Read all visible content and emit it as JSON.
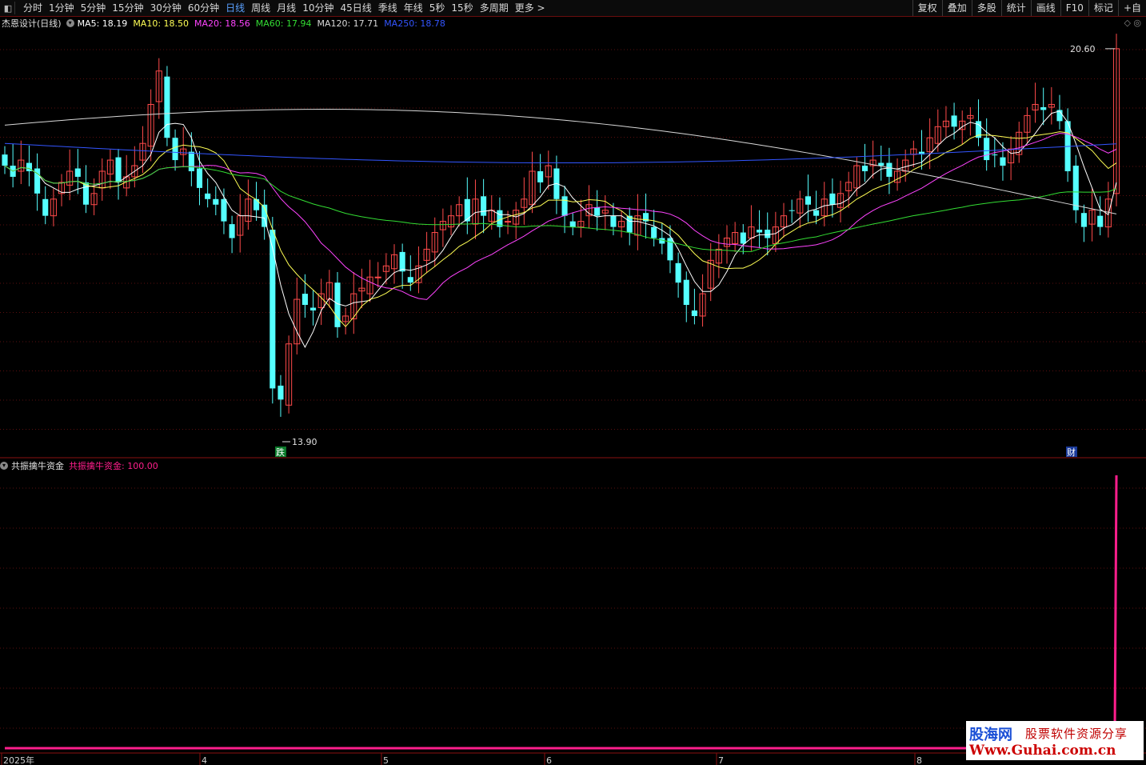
{
  "toolbar": {
    "menu_icon": "square-menu-icon",
    "periods": [
      "分时",
      "1分钟",
      "5分钟",
      "15分钟",
      "30分钟",
      "60分钟",
      "日线",
      "周线",
      "月线",
      "10分钟",
      "45日线",
      "季线",
      "年线",
      "5秒",
      "15秒",
      "多周期",
      "更多 >"
    ],
    "active_period": "日线",
    "tools": [
      "复权",
      "叠加",
      "多股",
      "统计",
      "画线",
      "F10",
      "标记",
      "+自"
    ]
  },
  "main_chart": {
    "title": "杰恩设计(日线)",
    "ma_legend": [
      {
        "label": "MA5: 18.19",
        "color": "#ffffff"
      },
      {
        "label": "MA10: 18.50",
        "color": "#ffff55"
      },
      {
        "label": "MA20: 18.56",
        "color": "#ff44ff"
      },
      {
        "label": "MA60: 17.94",
        "color": "#33dd33"
      },
      {
        "label": "MA120: 17.71",
        "color": "#d8d8d8"
      },
      {
        "label": "MA250: 18.78",
        "color": "#3355ff"
      }
    ],
    "high_label": "20.60",
    "low_label": "13.90",
    "marker_low": "跌",
    "marker_recent": "财",
    "corner_icons": "◇ ◎"
  },
  "indicator": {
    "title": "共振擒牛资金",
    "value_label": "共振擒牛资金: 100.00",
    "value_color": "#ff1e8c"
  },
  "x_axis_labels": [
    "2025年",
    "4",
    "5",
    "6",
    "7",
    "8"
  ],
  "watermark": {
    "brand": "股海网",
    "slogan": "股票软件资源分享",
    "url": "Www.Guhai.com.cn"
  },
  "chart_data": {
    "type": "candlestick",
    "stock": "杰恩设计",
    "period": "日线",
    "x_labels": [
      "2025年",
      "4",
      "5",
      "6",
      "7",
      "8"
    ],
    "price_range": [
      13.9,
      20.6
    ],
    "closes": [
      18.5,
      18.3,
      18.6,
      18.4,
      18.0,
      17.6,
      17.9,
      18.2,
      18.4,
      18.3,
      17.8,
      18.0,
      18.4,
      18.6,
      18.2,
      18.3,
      18.5,
      18.9,
      19.6,
      20.2,
      19.0,
      18.6,
      18.8,
      18.4,
      18.1,
      17.9,
      17.8,
      17.5,
      17.2,
      17.6,
      17.9,
      17.7,
      17.4,
      14.5,
      14.3,
      15.3,
      16.1,
      16.0,
      15.9,
      16.2,
      16.4,
      15.6,
      15.8,
      16.2,
      16.3,
      16.5,
      16.5,
      16.7,
      16.9,
      16.6,
      16.4,
      16.7,
      17.0,
      17.3,
      17.5,
      17.6,
      17.8,
      17.5,
      17.9,
      17.6,
      17.7,
      17.4,
      17.5,
      17.7,
      17.9,
      18.4,
      18.2,
      18.5,
      17.9,
      17.6,
      17.4,
      17.5,
      17.8,
      17.6,
      17.7,
      17.4,
      17.5,
      17.3,
      17.6,
      17.5,
      17.2,
      17.1,
      16.8,
      16.4,
      16.0,
      15.8,
      16.2,
      16.8,
      17.0,
      17.2,
      17.3,
      17.1,
      17.4,
      17.3,
      17.2,
      17.4,
      17.6,
      17.7,
      17.9,
      17.8,
      17.6,
      17.9,
      17.8,
      18.0,
      18.2,
      18.5,
      18.4,
      18.6,
      18.5,
      18.3,
      18.4,
      18.6,
      18.8,
      18.7,
      19.0,
      19.2,
      19.3,
      19.2,
      19.3,
      19.4,
      19.0,
      18.6,
      18.7,
      18.5,
      18.8,
      19.1,
      19.4,
      19.6,
      19.5,
      19.6,
      19.3,
      18.4,
      17.7,
      17.4,
      17.7,
      17.4,
      17.9,
      20.6
    ],
    "ma_current": {
      "MA5": 18.19,
      "MA10": 18.5,
      "MA20": 18.56,
      "MA60": 17.94,
      "MA120": 17.71,
      "MA250": 18.78
    },
    "indicator_series": {
      "name": "共振擒牛资金",
      "last": 100.0
    }
  }
}
